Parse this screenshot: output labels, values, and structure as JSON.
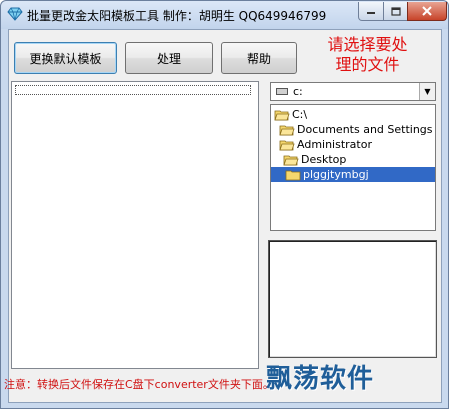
{
  "window": {
    "title": "批量更改金太阳模板工具 制作：胡明生 QQ649946799"
  },
  "toolbar": {
    "default_template_label": "更换默认模板",
    "process_label": "处理",
    "help_label": "帮助"
  },
  "hint": {
    "line1": "请选择要处",
    "line2": "理的文件"
  },
  "drive": {
    "selected": "c:"
  },
  "directories": [
    {
      "label": "C:\\"
    },
    {
      "label": "Documents and Settings"
    },
    {
      "label": "Administrator"
    },
    {
      "label": "Desktop"
    },
    {
      "label": "plggjtymbgj"
    }
  ],
  "status": {
    "note": "注意：转换后文件保存在C盘下converter文件夹下面。"
  },
  "watermark": "飘荡软件",
  "colors": {
    "hint_red": "#e01010",
    "selection_blue": "#3169c6",
    "watermark_blue": "#1f5e99"
  }
}
